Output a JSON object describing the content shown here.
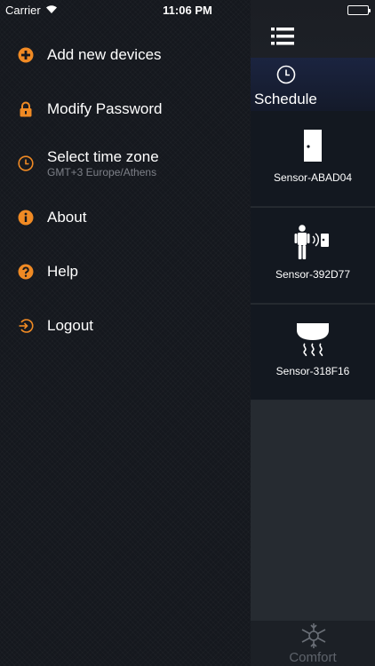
{
  "status_bar": {
    "carrier": "Carrier",
    "time": "11:06 PM"
  },
  "menu": {
    "items": [
      {
        "label": "Add new devices",
        "icon": "plus-circle-icon"
      },
      {
        "label": "Modify Password",
        "icon": "lock-icon"
      },
      {
        "label": "Select time zone",
        "sublabel": "GMT+3 Europe/Athens",
        "icon": "clock-icon"
      },
      {
        "label": "About",
        "icon": "info-icon"
      },
      {
        "label": "Help",
        "icon": "help-icon"
      },
      {
        "label": "Logout",
        "icon": "logout-icon"
      }
    ]
  },
  "panel": {
    "schedule_label": "Schedule",
    "sensors": [
      {
        "name": "Sensor-ABAD04",
        "icon": "door-icon"
      },
      {
        "name": "Sensor-392D77",
        "icon": "motion-sensor-icon"
      },
      {
        "name": "Sensor-318F16",
        "icon": "smoke-detector-icon"
      }
    ],
    "bottom_label": "Comfort"
  },
  "colors": {
    "accent": "#f08a24",
    "background": "#15181e",
    "panel": "#262b31"
  }
}
